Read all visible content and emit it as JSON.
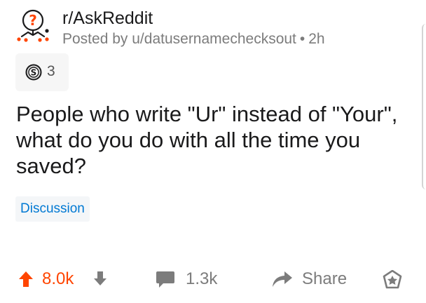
{
  "post": {
    "subreddit": "r/AskReddit",
    "posted_by_prefix": "Posted by",
    "author": "u/datusernamechecksout",
    "separator": "•",
    "age": "2h",
    "award_count": "3",
    "title": "People who write \"Ur\" instead of \"Your\", what do you do with all the time you saved?",
    "flair": "Discussion"
  },
  "actions": {
    "upvotes": "8.0k",
    "comments": "1.3k",
    "share_label": "Share"
  },
  "icons": {
    "subreddit": "askreddit-snoo-question-icon",
    "award": "silver-coin-award-icon",
    "upvote": "upvote-arrow-icon",
    "downvote": "downvote-arrow-icon",
    "comment": "comment-bubble-icon",
    "share": "share-arrow-icon",
    "give_award": "give-award-icon"
  },
  "colors": {
    "upvote": "#ff4500",
    "flair_text": "#0079d3",
    "meta_text": "#7c7c7c",
    "title_text": "#1a1a1b"
  }
}
